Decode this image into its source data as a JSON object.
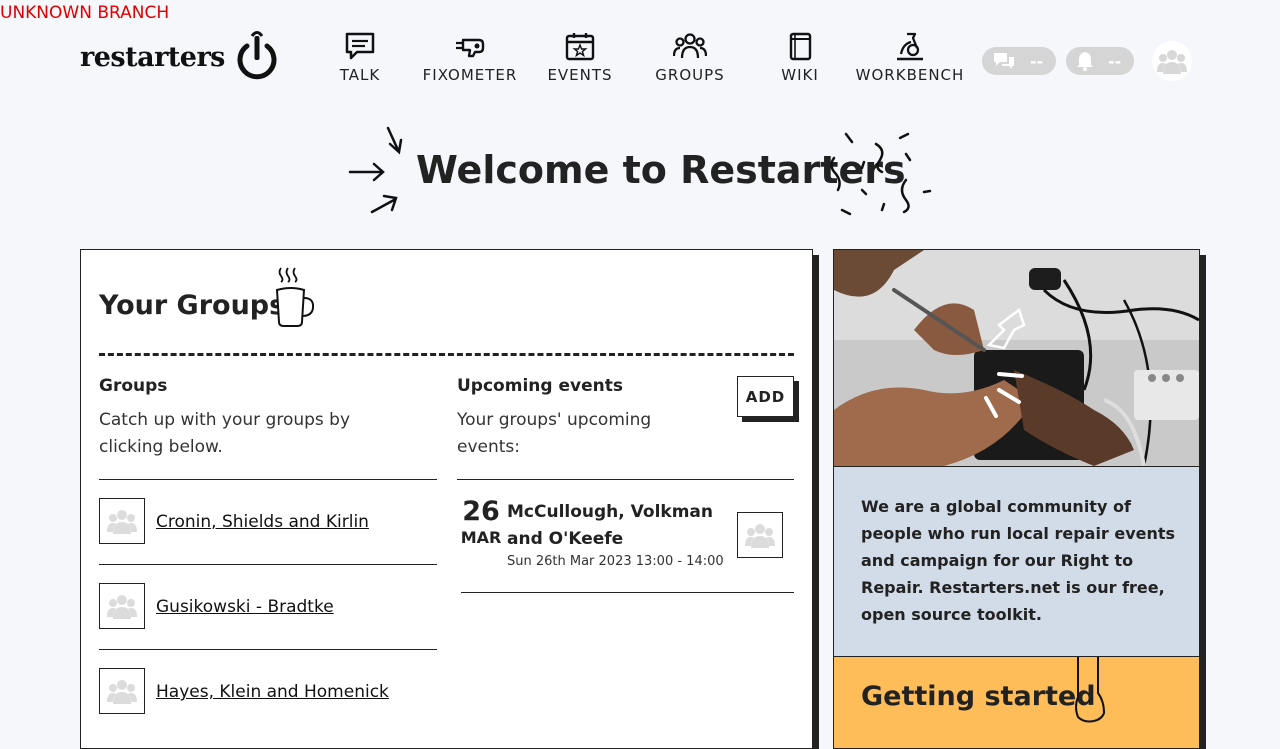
{
  "branch_label": "UNKNOWN BRANCH",
  "logo": {
    "text": "restarters"
  },
  "nav": [
    {
      "label": "TALK",
      "icon": "talk-icon"
    },
    {
      "label": "FIXOMETER",
      "icon": "fixometer-icon"
    },
    {
      "label": "EVENTS",
      "icon": "events-icon"
    },
    {
      "label": "GROUPS",
      "icon": "groups-icon"
    },
    {
      "label": "WIKI",
      "icon": "wiki-icon"
    },
    {
      "label": "WORKBENCH",
      "icon": "workbench-icon"
    }
  ],
  "header_counters": {
    "talk_count": "--",
    "notification_count": "--"
  },
  "welcome": {
    "title": "Welcome to Restarters"
  },
  "your_groups": {
    "title": "Your Groups",
    "groups_heading": "Groups",
    "groups_text": "Catch up with your groups by clicking below.",
    "groups": [
      {
        "name": "Cronin, Shields and Kirlin"
      },
      {
        "name": "Gusikowski - Bradtke"
      },
      {
        "name": "Hayes, Klein and Homenick"
      }
    ],
    "events_heading": "Upcoming events",
    "events_text": "Your groups' upcoming events:",
    "add_label": "ADD",
    "events": [
      {
        "day": "26",
        "month": "MAR",
        "name": "McCullough, Volkman and O'Keefe",
        "datetime": "Sun 26th Mar 2023 13:00 - 14:00"
      }
    ]
  },
  "sidebar": {
    "intro_text": "We are a global community of people who run local repair events and campaign for our Right to Repair. Restarters.net is our free, open source toolkit.",
    "getting_started_title": "Getting started"
  },
  "colors": {
    "background": "#f6f7fb",
    "branch_warning": "#e00000",
    "blue_panel": "#d2dbe8",
    "yellow_panel": "#ffbd5a",
    "pill_grey": "#d5d5d5"
  }
}
